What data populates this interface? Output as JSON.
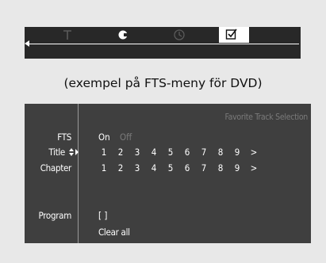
{
  "top_bar": {
    "icons": [
      "t-icon",
      "disc-c-icon",
      "clock-icon",
      "checkbox-checked-icon"
    ],
    "selected_icon": "checkbox-checked-icon"
  },
  "caption": "(exempel på FTS-meny för DVD)",
  "menu": {
    "header": "Favorite Track Selection",
    "fts": {
      "label": "FTS",
      "on": "On",
      "off": "Off",
      "selected": "On"
    },
    "title": {
      "label": "Title",
      "numbers": [
        "1",
        "2",
        "3",
        "4",
        "5",
        "6",
        "7",
        "8",
        "9",
        ">"
      ]
    },
    "chapter": {
      "label": "Chapter",
      "numbers": [
        "1",
        "2",
        "3",
        "4",
        "5",
        "6",
        "7",
        "8",
        "9",
        ">"
      ]
    },
    "program": {
      "label": "Program",
      "value": "[ ]"
    },
    "clear_all": "Clear all"
  },
  "colors": {
    "background": "#e8e8e8",
    "top_bar": "#282828",
    "panel": "#3f3f3f",
    "text": "#ffffff",
    "muted_text": "#7a7a7a"
  }
}
